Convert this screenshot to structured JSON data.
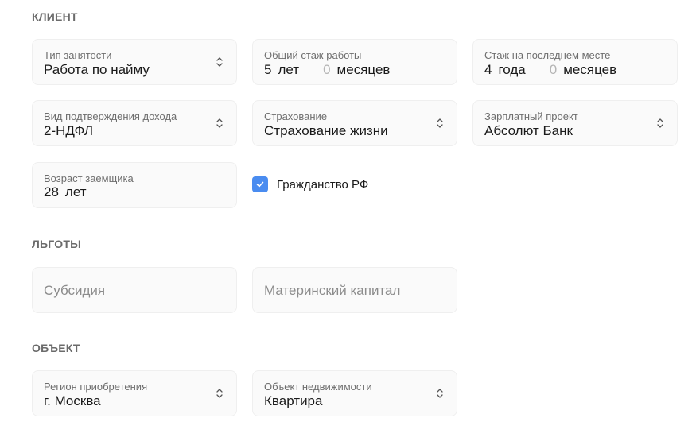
{
  "sections": {
    "client": "КЛИЕНТ",
    "benefits": "ЛЬГОТЫ",
    "object": "ОБЪЕКТ"
  },
  "client": {
    "employment_type": {
      "label": "Тип занятости",
      "value": "Работа по найму"
    },
    "total_experience": {
      "label": "Общий стаж работы",
      "years": "5",
      "years_unit": "лет",
      "months": "0",
      "months_unit": "месяцев"
    },
    "last_job_experience": {
      "label": "Стаж на последнем месте",
      "years": "4",
      "years_unit": "года",
      "months": "0",
      "months_unit": "месяцев"
    },
    "income_confirmation": {
      "label": "Вид подтверждения дохода",
      "value": "2-НДФЛ"
    },
    "insurance": {
      "label": "Страхование",
      "value": "Страхование жизни"
    },
    "salary_project": {
      "label": "Зарплатный проект",
      "value": "Абсолют Банк"
    },
    "borrower_age": {
      "label": "Возраст заемщика",
      "value": "28",
      "unit": "лет"
    },
    "citizenship": {
      "label": "Гражданство РФ",
      "checked": true
    }
  },
  "benefits": {
    "subsidy": {
      "placeholder": "Субсидия"
    },
    "maternity_capital": {
      "placeholder": "Материнский капитал"
    }
  },
  "object": {
    "region": {
      "label": "Регион приобретения",
      "value": "г. Москва"
    },
    "property": {
      "label": "Объект недвижимости",
      "value": "Квартира"
    }
  },
  "colors": {
    "accent": "#4a8cf0",
    "field_bg": "#fafafa",
    "section_title": "#6b6b6b"
  }
}
